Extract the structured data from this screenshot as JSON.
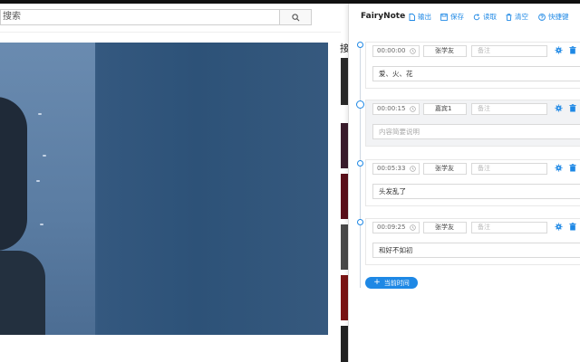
{
  "page": {
    "search": {
      "value": "搜索"
    },
    "side_label": "接"
  },
  "panel": {
    "brand": "FairyNote",
    "toolbar": [
      {
        "label": "输出",
        "icon": "file-export-icon"
      },
      {
        "label": "保存",
        "icon": "save-icon"
      },
      {
        "label": "读取",
        "icon": "reload-icon"
      },
      {
        "label": "清空",
        "icon": "trash-icon"
      },
      {
        "label": "快捷键",
        "icon": "help-icon"
      }
    ],
    "notes": [
      {
        "time": "00:00:00",
        "speaker": "张学友",
        "remark_placeholder": "备注",
        "content": "爱、火、花",
        "content_placeholder": "",
        "active": false
      },
      {
        "time": "00:00:15",
        "speaker": "嘉宾1",
        "remark_placeholder": "备注",
        "content": "",
        "content_placeholder": "内容简要说明",
        "active": true
      },
      {
        "time": "00:05:33",
        "speaker": "张学友",
        "remark_placeholder": "备注",
        "content": "头发乱了",
        "content_placeholder": "",
        "active": false
      },
      {
        "time": "00:09:25",
        "speaker": "张学友",
        "remark_placeholder": "备注",
        "content": "和好不如初",
        "content_placeholder": "",
        "active": false
      }
    ],
    "add_button": "当前时间"
  },
  "colors": {
    "accent": "#1e88e5",
    "video_blue": "#2d5278"
  }
}
